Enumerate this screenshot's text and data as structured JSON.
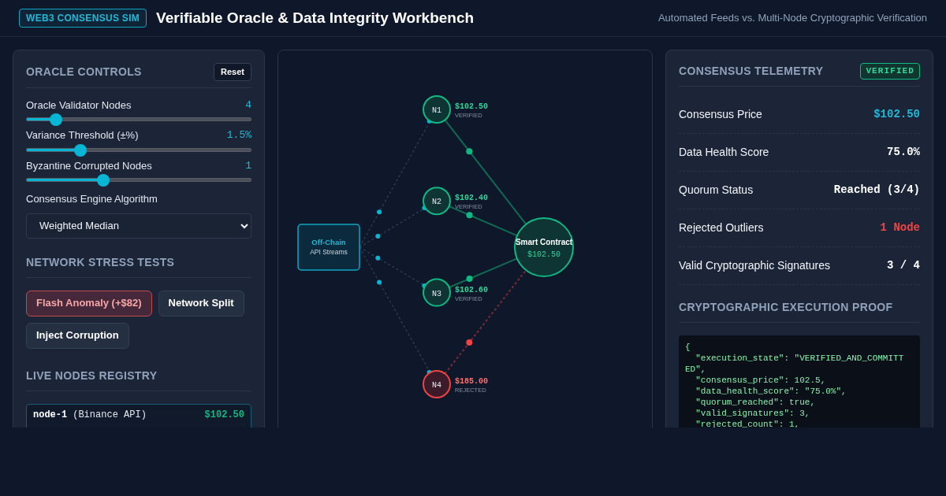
{
  "header": {
    "badge": "WEB3 CONSENSUS SIM",
    "title": "Verifiable Oracle & Data Integrity Workbench",
    "subtitle": "Automated Feeds vs. Multi-Node Cryptographic Verification"
  },
  "controls": {
    "title": "ORACLE CONTROLS",
    "reset": "Reset",
    "sliders": [
      {
        "label": "Oracle Validator Nodes",
        "reading": "4",
        "level": 0.13
      },
      {
        "label": "Variance Threshold (±%)",
        "reading": "1.5%",
        "level": 0.24
      },
      {
        "label": "Byzantine Corrupted Nodes",
        "reading": "1",
        "level": 0.34
      }
    ],
    "algorithm": {
      "label": "Consensus Engine Algorithm",
      "value": "Weighted Median"
    }
  },
  "stress_tests": {
    "title": "NETWORK STRESS TESTS",
    "buttons": [
      {
        "label": "Flash Anomaly (+$82)",
        "selected": true
      },
      {
        "label": "Network Split",
        "selected": false
      },
      {
        "label": "Inject Corruption",
        "selected": false
      }
    ]
  },
  "registry": {
    "title": "LIVE NODES REGISTRY",
    "rows": [
      {
        "node": "node-1",
        "source": "(Binance API)",
        "price": "$102.50"
      }
    ]
  },
  "diagram": {
    "source": {
      "title": "Off-Chain",
      "subtitle": "API Streams"
    },
    "nodes": [
      {
        "label": "N1",
        "price": "$102.50",
        "status": "VERIFIED",
        "kind": "verified"
      },
      {
        "label": "N2",
        "price": "$102.40",
        "status": "VERIFIED",
        "kind": "verified"
      },
      {
        "label": "N3",
        "price": "$102.60",
        "status": "VERIFIED",
        "kind": "verified"
      },
      {
        "label": "N4",
        "price": "$185.00",
        "status": "REJECTED",
        "kind": "rejected"
      }
    ],
    "contract": {
      "title": "Smart Contract",
      "price": "$102.50"
    }
  },
  "telemetry": {
    "title": "CONSENSUS TELEMETRY",
    "badge": "VERIFIED",
    "rows": [
      {
        "label": "Consensus Price",
        "value": "$102.50",
        "kind": "accent"
      },
      {
        "label": "Data Health Score",
        "value": "75.0%",
        "kind": "plain"
      },
      {
        "label": "Quorum Status",
        "value": "Reached (3/4)",
        "kind": "plain"
      },
      {
        "label": "Rejected Outliers",
        "value": "1 Node",
        "kind": "alert"
      },
      {
        "label": "Valid Cryptographic Signatures",
        "value": "3 / 4",
        "kind": "plain"
      }
    ]
  },
  "proof": {
    "title": "CRYPTOGRAPHIC EXECUTION PROOF",
    "lines": [
      "{",
      "  \"execution_state\": \"VERIFIED_AND_COMMITT",
      "ED\",",
      "  \"consensus_price\": 102.5,",
      "  \"data_health_score\": \"75.0%\",",
      "  \"quorum_reached\": true,",
      "  \"valid_signatures\": 3,",
      "  \"rejected_count\": 1,"
    ]
  }
}
